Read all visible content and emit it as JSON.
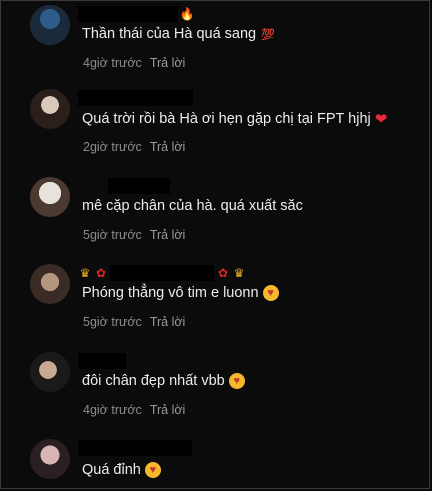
{
  "comments": [
    {
      "text": "Thần thái của Hà quá sang",
      "emoji": "💯",
      "time": "4giờ trước",
      "reply": "Trả lời",
      "avatar_colors": [
        "#1b2a3a",
        "#2e5c8a"
      ]
    },
    {
      "text": "Quá trời rồi bà Hà ơi hẹn gặp chị tại FPT hjhj",
      "emoji": "❤",
      "time": "2giờ trước",
      "reply": "Trả lời",
      "avatar_colors": [
        "#d9c9bb",
        "#2a1f1a"
      ]
    },
    {
      "text": "mê cặp chân của hà. quá xuất săc",
      "emoji": "",
      "time": "5giờ trước",
      "reply": "Trả lời",
      "avatar_colors": [
        "#e8e2dc",
        "#4a3a30"
      ]
    },
    {
      "text": "Phóng thẳng vô tim e luonn",
      "emoji": "🥰",
      "time": "5giờ trước",
      "reply": "Trả lời",
      "avatar_colors": [
        "#3a2c24",
        "#b49680"
      ]
    },
    {
      "text": "đôi chân đẹp nhất vbb",
      "emoji": "🥰",
      "time": "4giờ trước",
      "reply": "Trả lời",
      "avatar_colors": [
        "#1a1a1a",
        "#c8a890"
      ]
    },
    {
      "text": "Quá đỉnh",
      "emoji": "🥰",
      "time": "",
      "reply": "",
      "avatar_colors": [
        "#2a2022",
        "#d8b4b4"
      ]
    }
  ]
}
